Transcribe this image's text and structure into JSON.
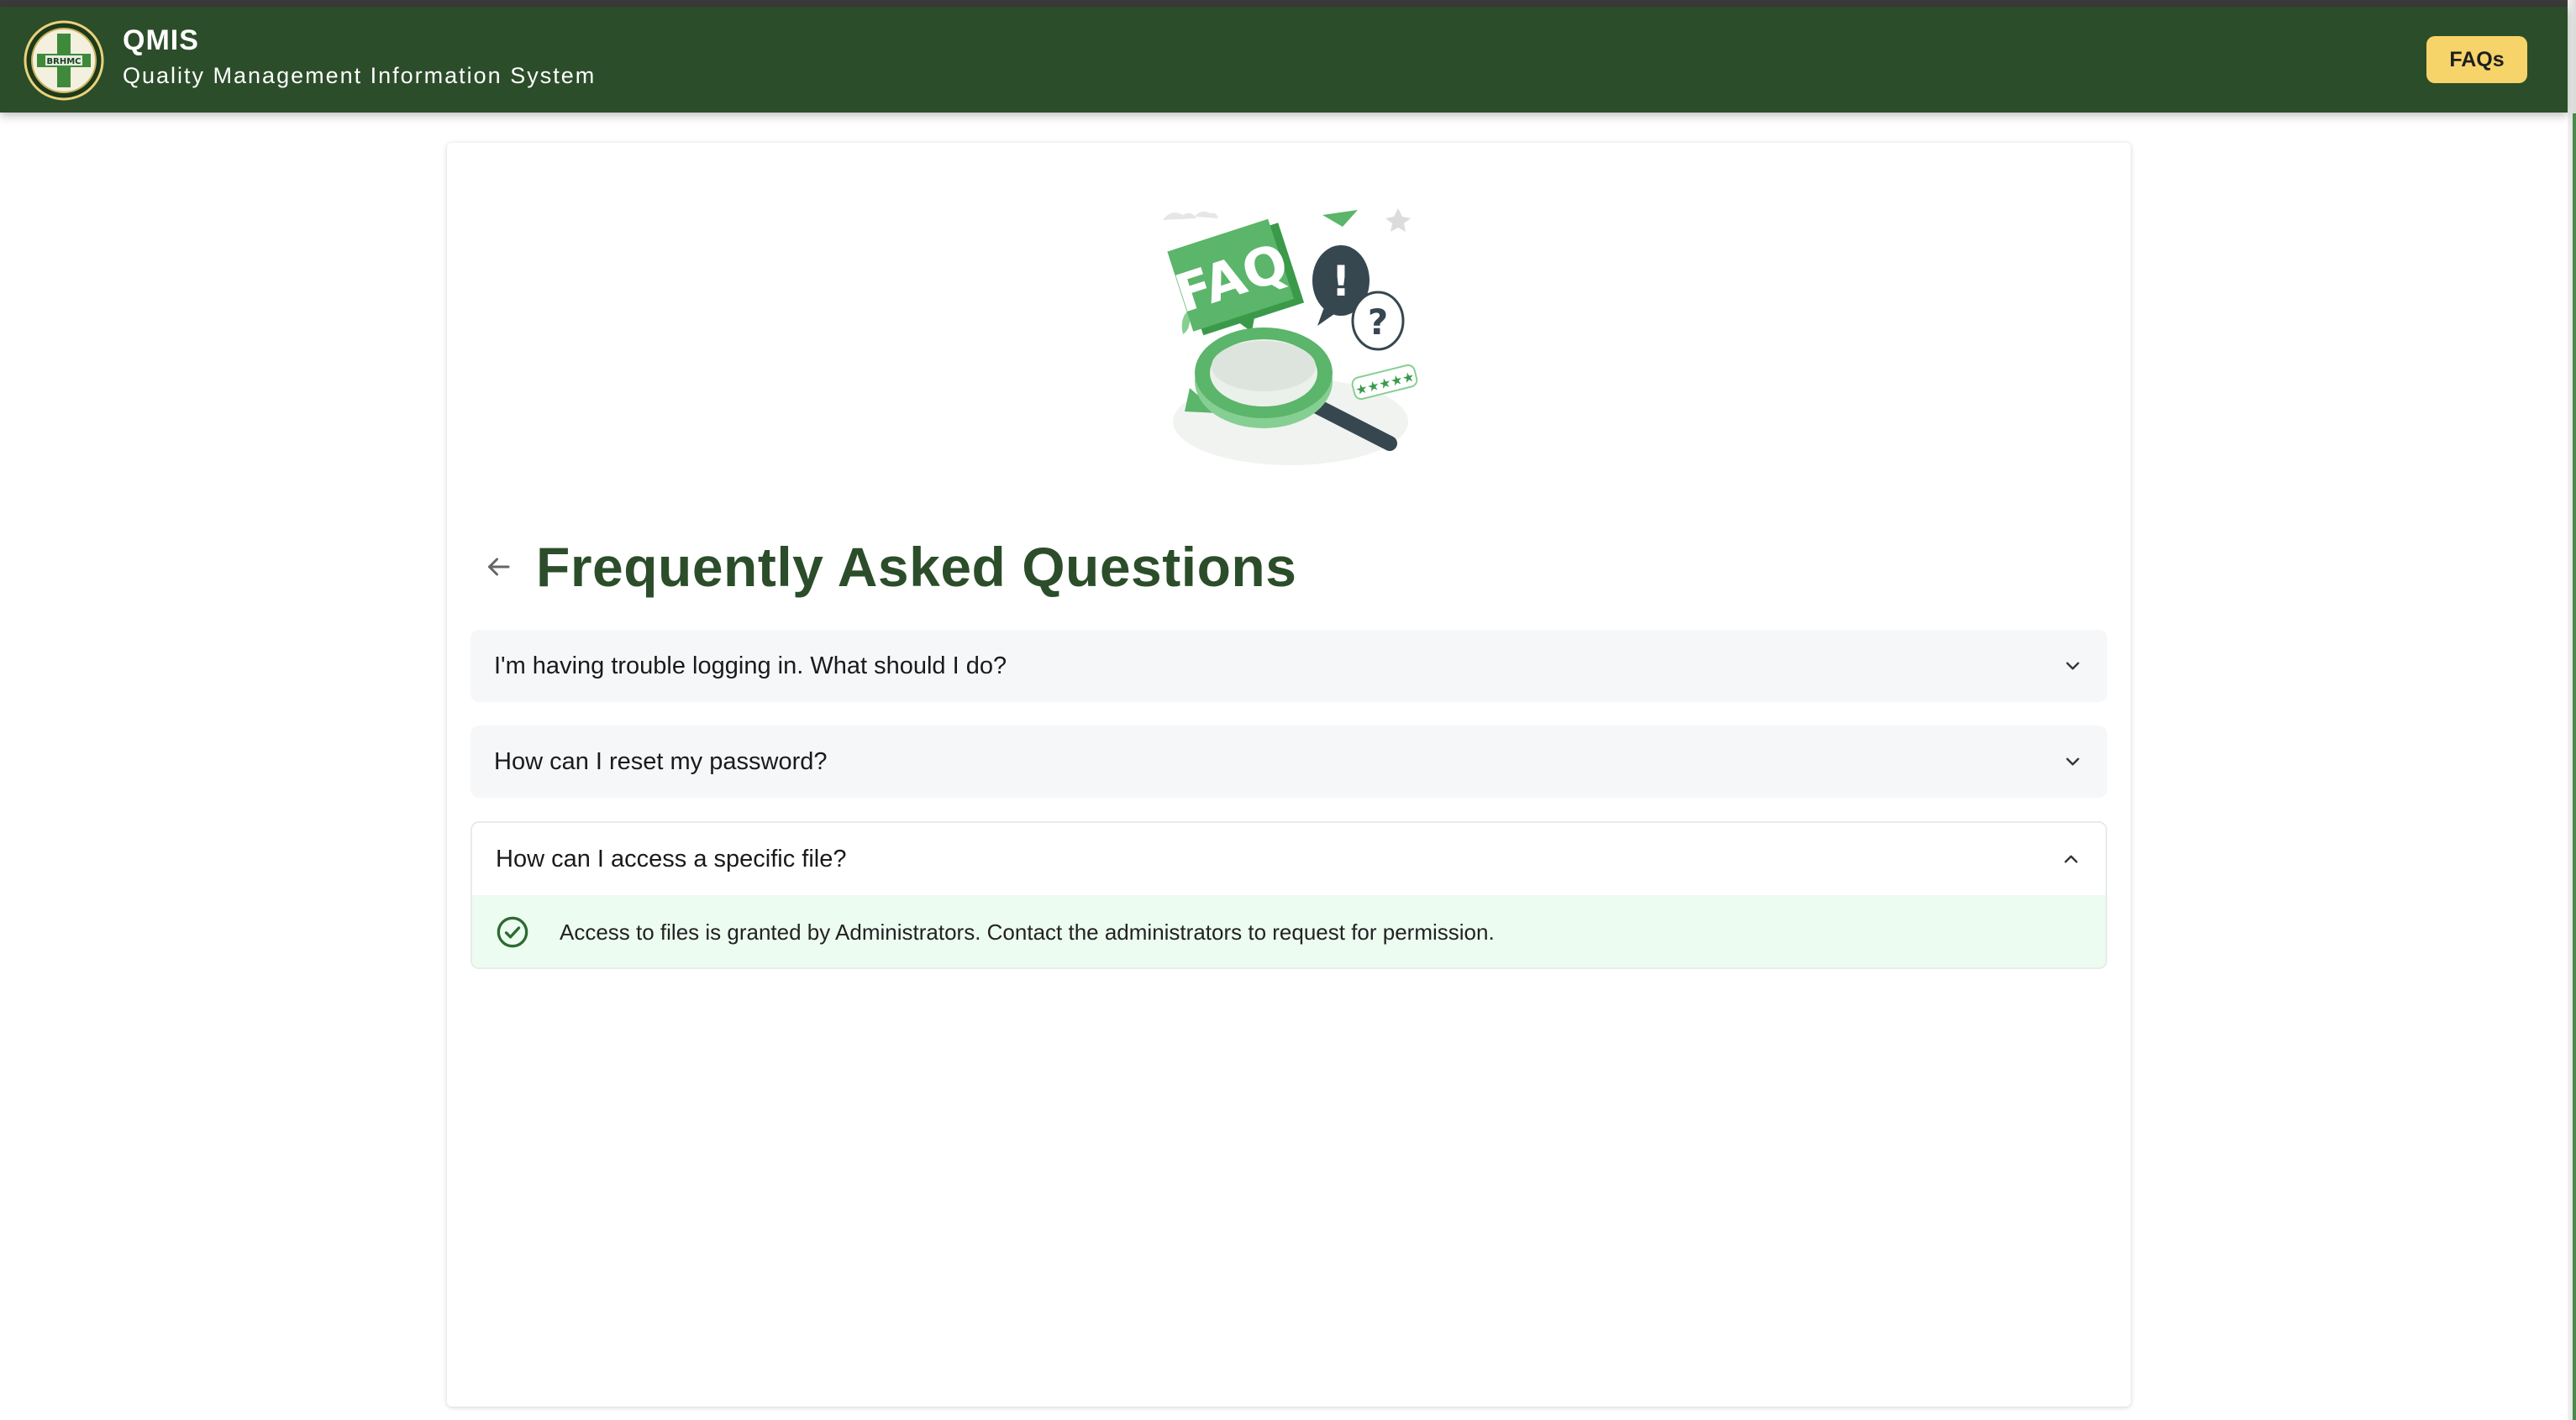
{
  "header": {
    "app_name": "QMIS",
    "app_subtitle": "Quality Management Information System",
    "logo_text": "BRHMC",
    "faqs_button": "FAQs",
    "background_color": "#2c4d2a",
    "button_color": "#f7d469"
  },
  "illustration": {
    "badge_text": "FAQ",
    "exclaim": "!",
    "question": "?",
    "stars": "★★★★★"
  },
  "page": {
    "title": "Frequently Asked Questions",
    "title_color": "#2c4d2a"
  },
  "faqs": [
    {
      "question": "I'm having trouble logging in. What should I do?",
      "expanded": false
    },
    {
      "question": "How can I reset my password?",
      "expanded": false
    },
    {
      "question": "How can I access a specific file?",
      "expanded": true,
      "answer": "Access to files is granted by Administrators. Contact the administrators to request for permission."
    }
  ],
  "icons": {
    "back": "arrow-left-icon",
    "collapsed": "chevron-down-icon",
    "expanded": "chevron-up-icon",
    "answer": "check-circle-icon"
  }
}
